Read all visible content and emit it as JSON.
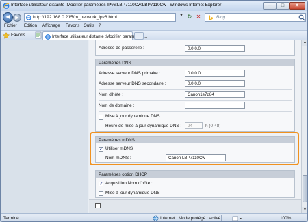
{
  "window": {
    "title": "Interface utilisateur distante :Modifier paramètres IPv6:LBP7110Cw:LBP7110Cw - Windows Internet Explorer",
    "minimize": "─",
    "maximize": "□",
    "close": "X"
  },
  "address_bar": {
    "url": "http://192.168.0.215/m_network_ipv6.html",
    "search_placeholder": "Bing"
  },
  "menu": [
    "Fichier",
    "Edition",
    "Affichage",
    "Favoris",
    "Outils",
    "?"
  ],
  "favorites_bar": {
    "label": "Favoris",
    "tab_title": "Interface utilisateur distante :Modifier paramètres..."
  },
  "form": {
    "gateway": {
      "label": "Adresse de passerelle :",
      "value": "0.0.0.0"
    },
    "dns_section": {
      "title": "Paramètres DNS",
      "primary": {
        "label": "Adresse serveur DNS primaire :",
        "value": "0.0.0.0"
      },
      "secondary": {
        "label": "Adresse serveur DNS secondaire :",
        "value": "0.0.0.0"
      },
      "hostname": {
        "label": "Nom d'hôte :",
        "value": "Canon1e7d84"
      },
      "domain": {
        "label": "Nom de domaine :",
        "value": ""
      },
      "dynamic_update": {
        "label": "Mise à jour dynamique DNS",
        "checked": false
      },
      "update_time": {
        "label": "Heure de mise à jour dynamique DNS :",
        "value": "24",
        "unit": "h (0-48)"
      }
    },
    "mdns_section": {
      "title": "Paramètres mDNS",
      "use_mdns": {
        "label": "Utiliser mDNS",
        "checked": true
      },
      "mdns_name": {
        "label": "Nom mDNS :",
        "value": "Canon LBP7110Cw"
      }
    },
    "dhcp_section": {
      "title": "Paramètres option DHCP",
      "acquire_hostname": {
        "label": "Acquisition Nom d'hôte :",
        "checked": true
      },
      "dynamic_dns": {
        "label": "Mise à jour dynamique DNS",
        "checked": false
      }
    }
  },
  "status_bar": {
    "text": "Terminé",
    "zone": "Internet | Mode protégé : activé",
    "zoom": "100%"
  },
  "colors": {
    "highlight": "#f0911f",
    "panel_header": "#c7ced8"
  }
}
